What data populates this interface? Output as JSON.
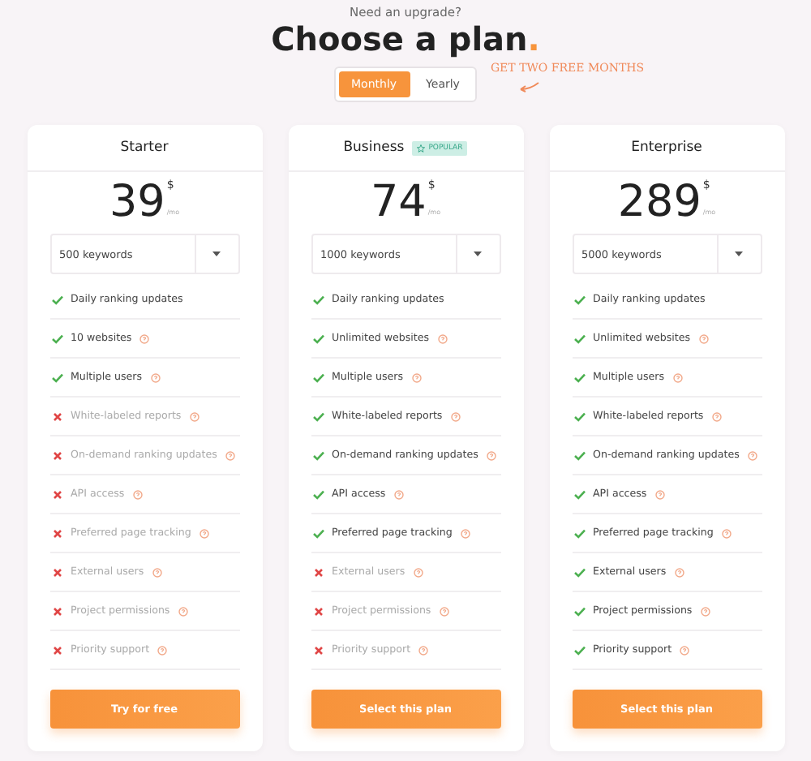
{
  "kicker": "Need an upgrade?",
  "title": "Choose a plan",
  "title_dot": ".",
  "billing": [
    {
      "label": "Monthly",
      "selected": true
    },
    {
      "label": "Yearly",
      "selected": false
    }
  ],
  "promo": "GET TWO FREE MONTHS",
  "plans": [
    {
      "name": "Starter",
      "price": "39",
      "currency": "$",
      "period": "/mo",
      "keywords": "500 keywords",
      "button": "Try for free",
      "features": [
        {
          "label": "Daily ranking updates",
          "included": true,
          "help": false
        },
        {
          "label": "10 websites",
          "included": true,
          "help": true
        },
        {
          "label": "Multiple users",
          "included": true,
          "help": true
        },
        {
          "label": "White-labeled reports",
          "included": false,
          "help": true
        },
        {
          "label": "On-demand ranking updates",
          "included": false,
          "help": true
        },
        {
          "label": "API access",
          "included": false,
          "help": true
        },
        {
          "label": "Preferred page tracking",
          "included": false,
          "help": true
        },
        {
          "label": "External users",
          "included": false,
          "help": true
        },
        {
          "label": "Project permissions",
          "included": false,
          "help": true
        },
        {
          "label": "Priority support",
          "included": false,
          "help": true
        }
      ]
    },
    {
      "name": "Business",
      "badge": "POPULAR",
      "price": "74",
      "currency": "$",
      "period": "/mo",
      "keywords": "1000 keywords",
      "button": "Select this plan",
      "features": [
        {
          "label": "Daily ranking updates",
          "included": true,
          "help": false
        },
        {
          "label": "Unlimited websites",
          "included": true,
          "help": true
        },
        {
          "label": "Multiple users",
          "included": true,
          "help": true
        },
        {
          "label": "White-labeled reports",
          "included": true,
          "help": true
        },
        {
          "label": "On-demand ranking updates",
          "included": true,
          "help": true
        },
        {
          "label": "API access",
          "included": true,
          "help": true
        },
        {
          "label": "Preferred page tracking",
          "included": true,
          "help": true
        },
        {
          "label": "External users",
          "included": false,
          "help": true
        },
        {
          "label": "Project permissions",
          "included": false,
          "help": true
        },
        {
          "label": "Priority support",
          "included": false,
          "help": true
        }
      ]
    },
    {
      "name": "Enterprise",
      "price": "289",
      "currency": "$",
      "period": "/mo",
      "keywords": "5000 keywords",
      "button": "Select this plan",
      "features": [
        {
          "label": "Daily ranking updates",
          "included": true,
          "help": false
        },
        {
          "label": "Unlimited websites",
          "included": true,
          "help": true
        },
        {
          "label": "Multiple users",
          "included": true,
          "help": true
        },
        {
          "label": "White-labeled reports",
          "included": true,
          "help": true
        },
        {
          "label": "On-demand ranking updates",
          "included": true,
          "help": true
        },
        {
          "label": "API access",
          "included": true,
          "help": true
        },
        {
          "label": "Preferred page tracking",
          "included": true,
          "help": true
        },
        {
          "label": "External users",
          "included": true,
          "help": true
        },
        {
          "label": "Project permissions",
          "included": true,
          "help": true
        },
        {
          "label": "Priority support",
          "included": true,
          "help": true
        }
      ]
    }
  ]
}
